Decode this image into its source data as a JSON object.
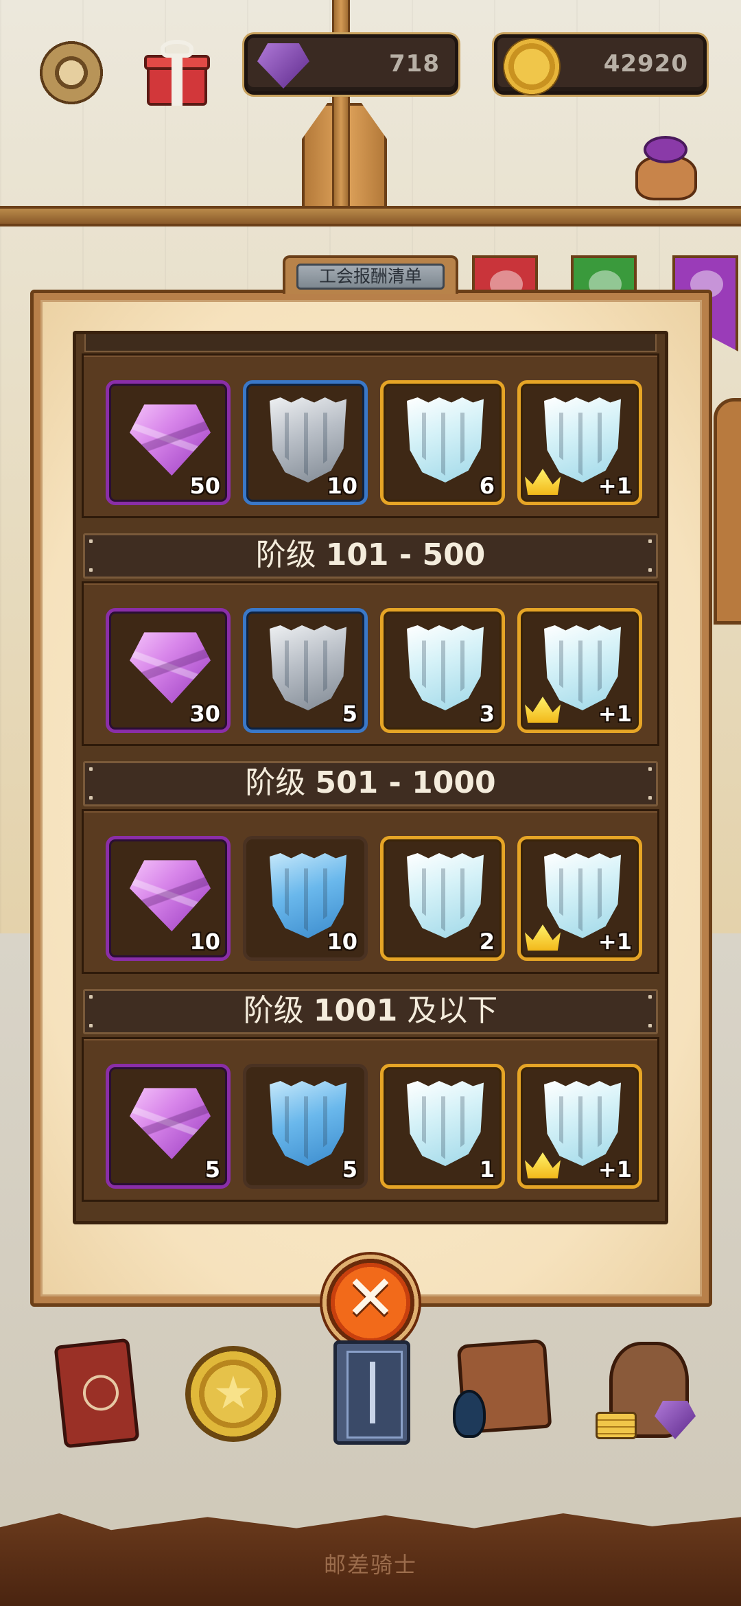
{
  "top_bar": {
    "gems": "718",
    "gold": "42920"
  },
  "modal": {
    "title": "工会报酬清单",
    "tiers": [
      {
        "label": "",
        "range": "",
        "rewards": [
          {
            "item": "purple-gem",
            "qty": "50",
            "frame": "purple"
          },
          {
            "item": "silver-shield",
            "qty": "10",
            "frame": "blue"
          },
          {
            "item": "ice-shield",
            "qty": "6",
            "frame": "gold"
          },
          {
            "item": "ice-shield-crown",
            "qty": "+1",
            "frame": "gold"
          }
        ]
      },
      {
        "label": "阶级",
        "range": "101 - 500",
        "rewards": [
          {
            "item": "purple-gem",
            "qty": "30",
            "frame": "purple"
          },
          {
            "item": "silver-shield",
            "qty": "5",
            "frame": "blue"
          },
          {
            "item": "ice-shield",
            "qty": "3",
            "frame": "gold"
          },
          {
            "item": "ice-shield-crown",
            "qty": "+1",
            "frame": "gold"
          }
        ]
      },
      {
        "label": "阶级",
        "range": "501 - 1000",
        "rewards": [
          {
            "item": "purple-gem",
            "qty": "10",
            "frame": "purple"
          },
          {
            "item": "blue-shield",
            "qty": "10",
            "frame": "plain"
          },
          {
            "item": "ice-shield",
            "qty": "2",
            "frame": "gold"
          },
          {
            "item": "ice-shield-crown",
            "qty": "+1",
            "frame": "gold"
          }
        ]
      },
      {
        "label": "阶级",
        "range": "1001",
        "suffix": "及以下",
        "rewards": [
          {
            "item": "purple-gem",
            "qty": "5",
            "frame": "purple"
          },
          {
            "item": "blue-shield",
            "qty": "5",
            "frame": "plain"
          },
          {
            "item": "ice-shield",
            "qty": "1",
            "frame": "gold"
          },
          {
            "item": "ice-shield-crown",
            "qty": "+1",
            "frame": "gold"
          }
        ]
      }
    ]
  },
  "bottom_caption": "邮差骑士",
  "colors": {
    "frame_purple": "#8a2ea8",
    "frame_blue": "#3a78c8",
    "frame_gold": "#e6a526",
    "close_button": "#f26a1a"
  }
}
